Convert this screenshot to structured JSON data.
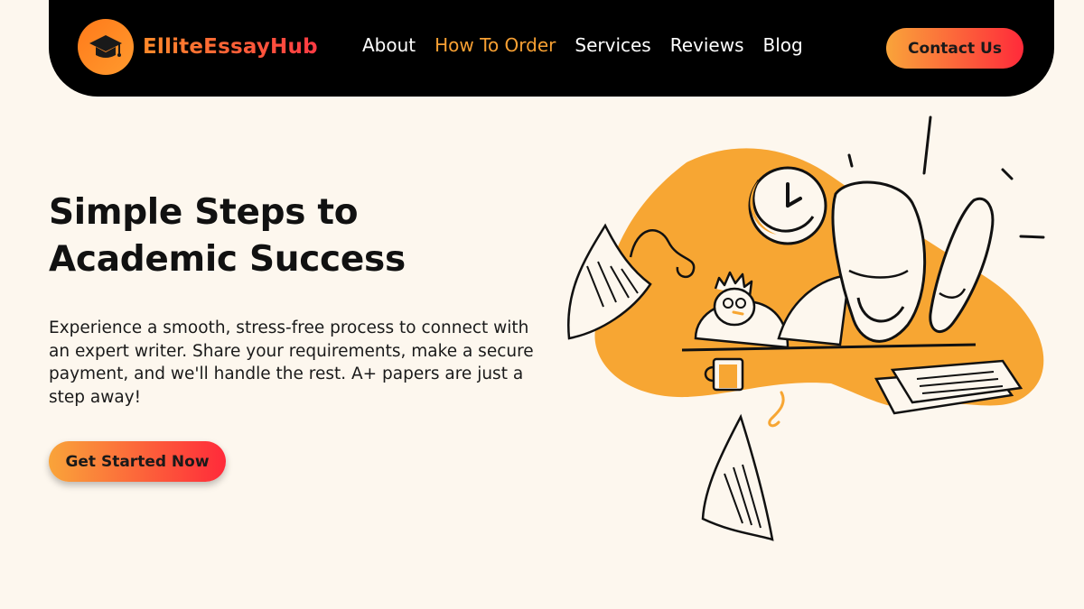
{
  "brand": {
    "name": "ElliteEssayHub",
    "logo_icon": "graduation-cap-icon",
    "accent": "#f7a033",
    "gradient_start": "#f9a43a",
    "gradient_end": "#ff2a3a"
  },
  "nav": {
    "items": [
      {
        "label": "About",
        "active": false
      },
      {
        "label": "How To Order",
        "active": true
      },
      {
        "label": "Services",
        "active": false
      },
      {
        "label": "Reviews",
        "active": false
      },
      {
        "label": "Blog",
        "active": false
      }
    ],
    "contact_label": "Contact Us"
  },
  "hero": {
    "title_line1": "Simple Steps to",
    "title_line2": "Academic Success",
    "description": "Experience a smooth, stress-free process to connect with an expert writer. Share your requirements, make a secure payment, and we'll handle the rest. A+ papers are just a step away!",
    "cta_label": "Get Started Now"
  },
  "illustration": {
    "subject": "person-relaxing-feet-on-desk-illustration",
    "blob_color": "#f7a633"
  }
}
